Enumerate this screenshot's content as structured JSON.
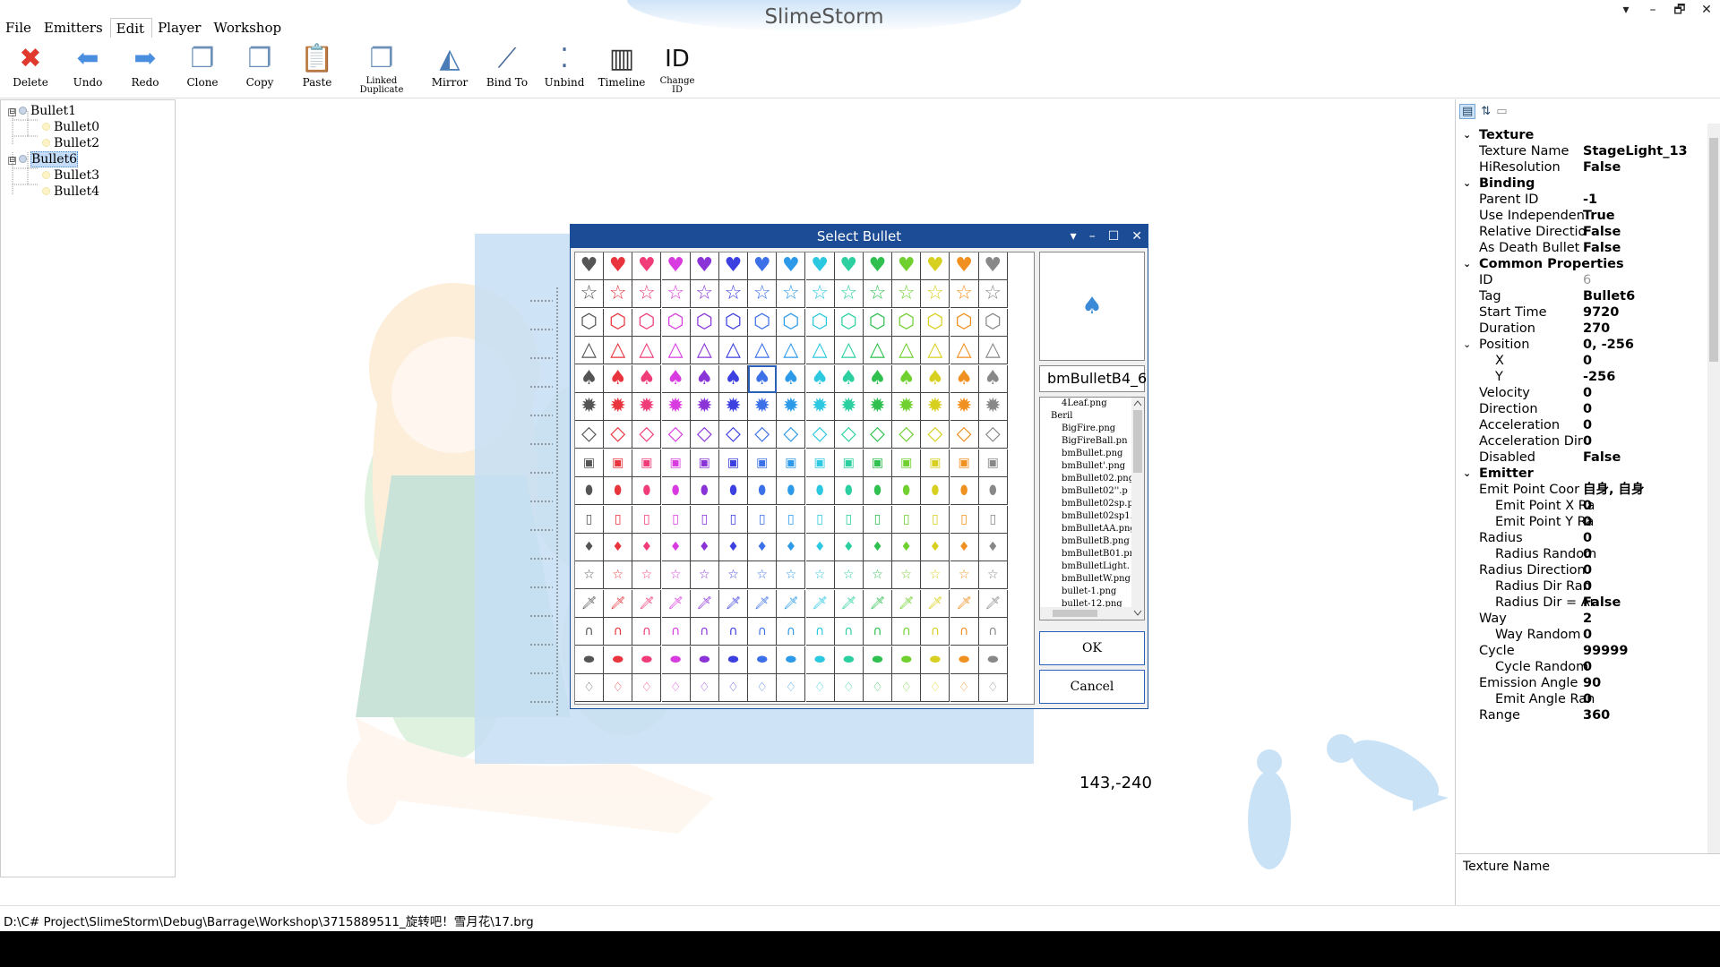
{
  "app_title": "SlimeStorm",
  "menu": [
    "File",
    "Emitters",
    "Edit",
    "Player",
    "Workshop"
  ],
  "menu_active": 2,
  "window_controls": [
    "▾",
    "–",
    "🗗",
    "✕"
  ],
  "toolbar": [
    {
      "label": "Delete",
      "icon": "✖",
      "color": "#e03a2e"
    },
    {
      "label": "Undo",
      "icon": "⬅",
      "color": "#4a8ee0"
    },
    {
      "label": "Redo",
      "icon": "➡",
      "color": "#4a8ee0"
    },
    {
      "label": "Clone",
      "icon": "❐",
      "color": "#6c8fb8"
    },
    {
      "label": "Copy",
      "icon": "❐",
      "color": "#6c8fb8"
    },
    {
      "label": "Paste",
      "icon": "📋",
      "color": "#b08a50"
    },
    {
      "label": "Linked\nDuplicate",
      "icon": "❐",
      "color": "#6c8fb8"
    },
    {
      "label": "Mirror",
      "icon": "◭",
      "color": "#4a7cb8"
    },
    {
      "label": "Bind To",
      "icon": "⟋",
      "color": "#4a6a9a"
    },
    {
      "label": "Unbind",
      "icon": "⁚",
      "color": "#4a6a9a"
    },
    {
      "label": "Timeline",
      "icon": "▥",
      "color": "#333333"
    },
    {
      "label": "Change\nID",
      "icon": "ID",
      "color": "#111111"
    }
  ],
  "tree": [
    {
      "label": "Bullet1",
      "level": 0,
      "expander": "⊟",
      "selected": false
    },
    {
      "label": "Bullet0",
      "level": 1,
      "expander": "",
      "selected": false
    },
    {
      "label": "Bullet2",
      "level": 1,
      "expander": "",
      "selected": false
    },
    {
      "label": "Bullet6",
      "level": 0,
      "expander": "⊟",
      "selected": true
    },
    {
      "label": "Bullet3",
      "level": 1,
      "expander": "",
      "selected": false
    },
    {
      "label": "Bullet4",
      "level": 1,
      "expander": "",
      "selected": false
    }
  ],
  "dialog": {
    "title": "Select Bullet",
    "controls": [
      "▾",
      "–",
      "☐",
      "✕"
    ],
    "selected_name": "bmBulletB4_6",
    "preview_glyph": "♠",
    "ok": "OK",
    "cancel": "Cancel",
    "files": [
      "4Leaf.png",
      "Beril",
      "BigFire.png",
      "BigFireBall.pn",
      "bmBullet.png",
      "bmBullet'.png",
      "bmBullet02.png",
      "bmBullet02''.p",
      "bmBullet02sp.p",
      "bmBullet02sp1.",
      "bmBulletAA.png",
      "bmBulletB.png",
      "bmBulletB01.pn",
      "bmBulletLight.",
      "bmBulletW.png",
      "bullet-1.png",
      "bullet-12.png"
    ],
    "palette": [
      "#555555",
      "#e8343c",
      "#f03c78",
      "#d83ce0",
      "#8a34d8",
      "#3c40e0",
      "#3c70e8",
      "#2c9ae8",
      "#2cc8e0",
      "#2cd0a0",
      "#30c050",
      "#70d030",
      "#d8d020",
      "#f09020",
      "#888888"
    ],
    "row_glyphs": [
      "♥",
      "☆",
      "⬡",
      "△",
      "♠",
      "✹",
      "◇",
      "▣",
      "⬮",
      "▯",
      "♦",
      "☆",
      "🗡",
      "∩",
      "⬬",
      "♢"
    ],
    "selected_cell": {
      "row": 4,
      "col": 6
    }
  },
  "coord_readout": "143,-240",
  "properties": [
    {
      "type": "cat",
      "k": "Texture"
    },
    {
      "k": "Texture Name",
      "v": "StageLight_13"
    },
    {
      "k": "HiResolution",
      "v": "False"
    },
    {
      "type": "cat",
      "k": "Binding"
    },
    {
      "k": "Parent ID",
      "v": "-1"
    },
    {
      "k": "Use Independen",
      "v": "True"
    },
    {
      "k": "Relative Directio",
      "v": "False"
    },
    {
      "k": "As Death Bullet",
      "v": "False"
    },
    {
      "type": "cat",
      "k": "Common Properties"
    },
    {
      "k": "ID",
      "v": "6",
      "dis": true
    },
    {
      "k": "Tag",
      "v": "Bullet6"
    },
    {
      "k": "Start Time",
      "v": "9720"
    },
    {
      "k": "Duration",
      "v": "270"
    },
    {
      "k": "Position",
      "v": "0, -256",
      "exp": "⌄"
    },
    {
      "k": "X",
      "v": "0",
      "sub": true
    },
    {
      "k": "Y",
      "v": "-256",
      "sub": true
    },
    {
      "k": "Velocity",
      "v": "0"
    },
    {
      "k": "Direction",
      "v": "0"
    },
    {
      "k": "Acceleration",
      "v": "0"
    },
    {
      "k": "Acceleration Dir",
      "v": "0"
    },
    {
      "k": "Disabled",
      "v": "False"
    },
    {
      "type": "cat",
      "k": "Emitter"
    },
    {
      "k": "Emit Point Coor",
      "v": "自身, 自身"
    },
    {
      "k": "Emit Point X Ra",
      "v": "0",
      "sub": true
    },
    {
      "k": "Emit Point Y Ra",
      "v": "0",
      "sub": true
    },
    {
      "k": "Radius",
      "v": "0"
    },
    {
      "k": "Radius Random",
      "v": "0",
      "sub": true
    },
    {
      "k": "Radius Direction",
      "v": "0"
    },
    {
      "k": "Radius Dir Ran",
      "v": "0",
      "sub": true
    },
    {
      "k": "Radius Dir = Ar",
      "v": "False",
      "sub": true
    },
    {
      "k": "Way",
      "v": "2"
    },
    {
      "k": "Way Random",
      "v": "0",
      "sub": true
    },
    {
      "k": "Cycle",
      "v": "99999"
    },
    {
      "k": "Cycle Random",
      "v": "0",
      "sub": true
    },
    {
      "k": "Emission Angle",
      "v": "90"
    },
    {
      "k": "Emit Angle Ran",
      "v": "0",
      "sub": true
    },
    {
      "k": "Range",
      "v": "360"
    }
  ],
  "property_description": "Texture Name",
  "status_path": "D:\\C# Project\\SlimeStorm\\Debug\\Barrage\\Workshop\\3715889511_旋转吧！雪月花\\17.brg"
}
